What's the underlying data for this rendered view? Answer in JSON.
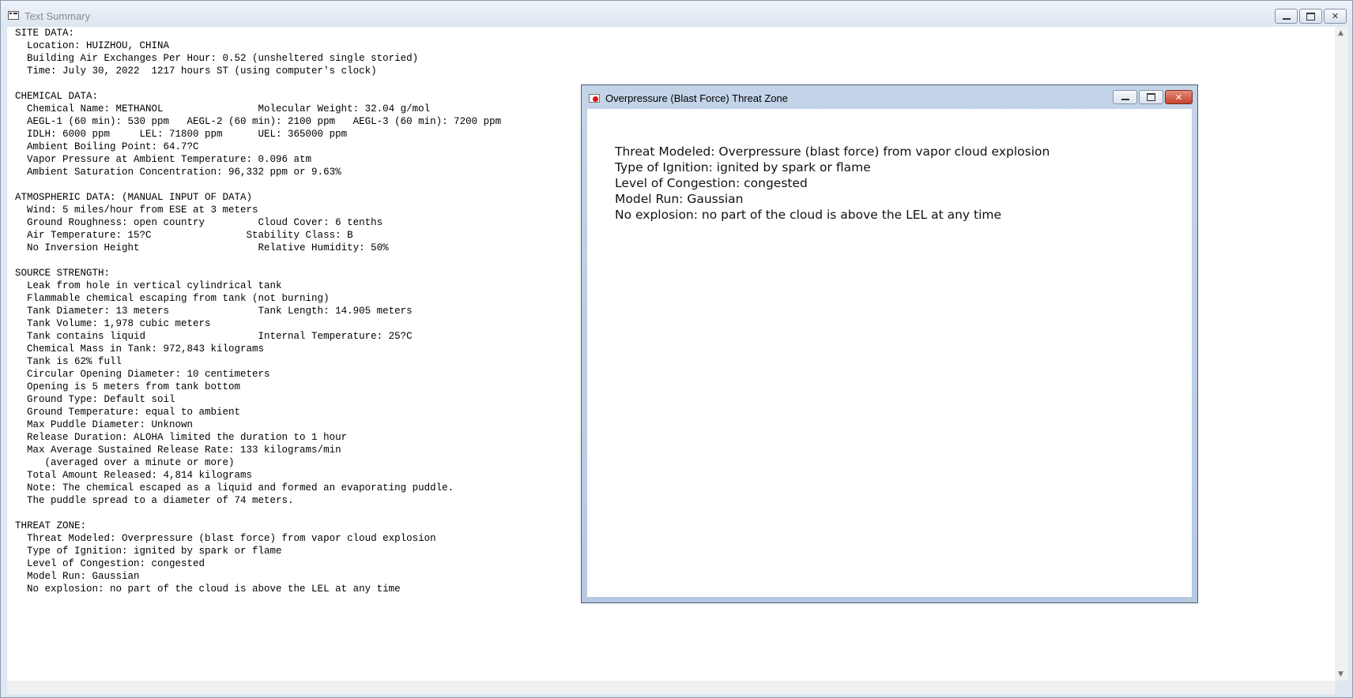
{
  "main_window": {
    "title": "Text Summary",
    "summary_lines": [
      "SITE DATA:",
      "  Location: HUIZHOU, CHINA",
      "  Building Air Exchanges Per Hour: 0.52 (unsheltered single storied)",
      "  Time: July 30, 2022  1217 hours ST (using computer's clock)",
      "",
      "CHEMICAL DATA:",
      "  Chemical Name: METHANOL                Molecular Weight: 32.04 g/mol",
      "  AEGL-1 (60 min): 530 ppm   AEGL-2 (60 min): 2100 ppm   AEGL-3 (60 min): 7200 ppm",
      "  IDLH: 6000 ppm     LEL: 71800 ppm      UEL: 365000 ppm",
      "  Ambient Boiling Point: 64.7?C",
      "  Vapor Pressure at Ambient Temperature: 0.096 atm",
      "  Ambient Saturation Concentration: 96,332 ppm or 9.63%",
      "",
      "ATMOSPHERIC DATA: (MANUAL INPUT OF DATA)",
      "  Wind: 5 miles/hour from ESE at 3 meters",
      "  Ground Roughness: open country         Cloud Cover: 6 tenths",
      "  Air Temperature: 15?C                Stability Class: B",
      "  No Inversion Height                    Relative Humidity: 50%",
      "",
      "SOURCE STRENGTH:",
      "  Leak from hole in vertical cylindrical tank",
      "  Flammable chemical escaping from tank (not burning)",
      "  Tank Diameter: 13 meters               Tank Length: 14.905 meters",
      "  Tank Volume: 1,978 cubic meters",
      "  Tank contains liquid                   Internal Temperature: 25?C",
      "  Chemical Mass in Tank: 972,843 kilograms",
      "  Tank is 62% full",
      "  Circular Opening Diameter: 10 centimeters",
      "  Opening is 5 meters from tank bottom",
      "  Ground Type: Default soil",
      "  Ground Temperature: equal to ambient",
      "  Max Puddle Diameter: Unknown",
      "  Release Duration: ALOHA limited the duration to 1 hour",
      "  Max Average Sustained Release Rate: 133 kilograms/min",
      "     (averaged over a minute or more)",
      "  Total Amount Released: 4,814 kilograms",
      "  Note: The chemical escaped as a liquid and formed an evaporating puddle.",
      "  The puddle spread to a diameter of 74 meters.",
      "",
      "THREAT ZONE:",
      "  Threat Modeled: Overpressure (blast force) from vapor cloud explosion",
      "  Type of Ignition: ignited by spark or flame",
      "  Level of Congestion: congested",
      "  Model Run: Gaussian",
      "  No explosion: no part of the cloud is above the LEL at any time"
    ]
  },
  "child_window": {
    "title": "Overpressure (Blast Force) Threat Zone",
    "lines": [
      "Threat Modeled: Overpressure (blast force) from vapor cloud explosion",
      "Type of Ignition: ignited by spark or flame",
      "Level of Congestion: congested",
      "Model Run: Gaussian",
      "No explosion: no part of the cloud is above the LEL at any time"
    ]
  },
  "colors": {
    "close_button": "#c6422c",
    "title_inactive": "#8a8a8a"
  }
}
